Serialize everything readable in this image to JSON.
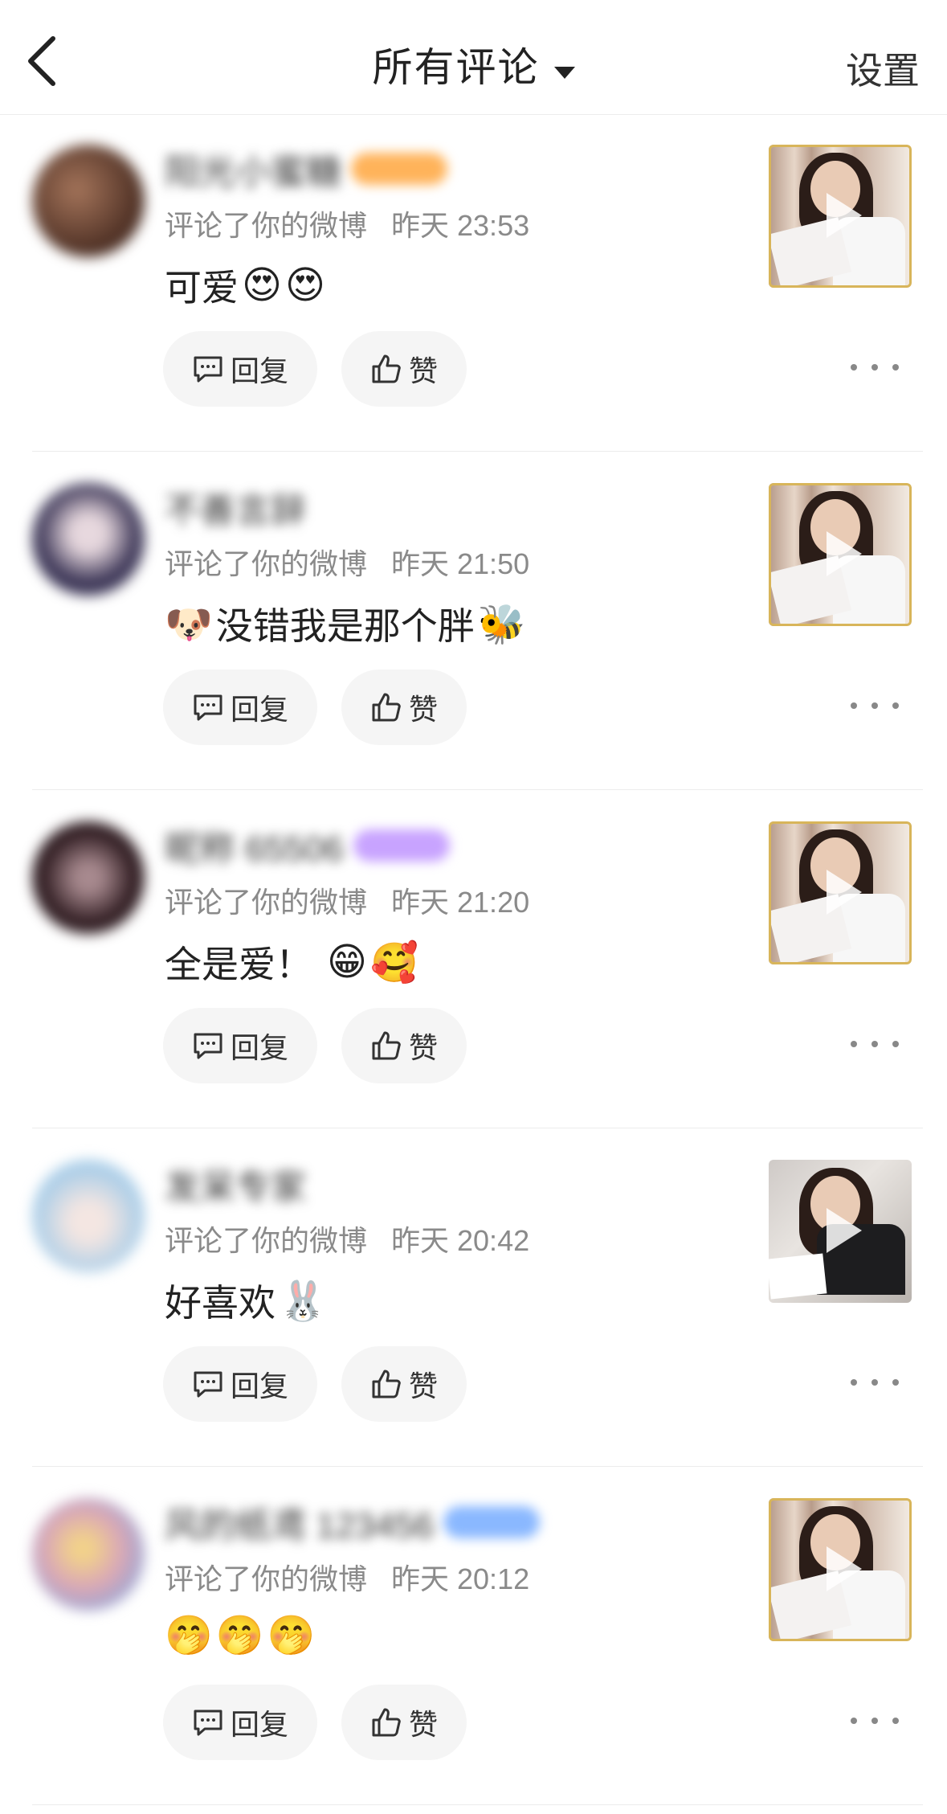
{
  "header": {
    "title": "所有评论",
    "settings_label": "设置"
  },
  "comments": [
    {
      "nickname": "阳光小蜜糖",
      "action": "评论了你的微博",
      "time": "昨天 23:53",
      "text": "可爱",
      "emojis": [
        "😍",
        "😍"
      ],
      "avatar_color": "#5a3b2c",
      "badge_color": "#ffb35a",
      "reply_label": "回复",
      "like_label": "赞"
    },
    {
      "nickname": "不善言辞",
      "action": "评论了你的微博",
      "time": "昨天 21:50",
      "text": "没错我是那个胖",
      "emoji_before": "🐶",
      "emojis": [
        "🐝"
      ],
      "avatar_color": "#3b3556",
      "badge_color": "",
      "reply_label": "回复",
      "like_label": "赞"
    },
    {
      "nickname": "昵称 65506",
      "action": "评论了你的微博",
      "time": "昨天 21:20",
      "text": "全是爱！",
      "emojis": [
        "😁",
        "🥰"
      ],
      "avatar_color": "#3a2429",
      "badge_color": "#c8a3ff",
      "reply_label": "回复",
      "like_label": "赞"
    },
    {
      "nickname": "发呆专家",
      "action": "评论了你的微博",
      "time": "昨天 20:42",
      "text": "好喜欢",
      "emojis": [
        "🐰"
      ],
      "avatar_color": "#bcd9ee",
      "badge_color": "",
      "reply_label": "回复",
      "like_label": "赞"
    },
    {
      "nickname": "风的纸鸢 123456",
      "action": "评论了你的微博",
      "time": "昨天 20:12",
      "text": "",
      "emojis": [
        "🤭",
        "🤭",
        "🤭"
      ],
      "avatar_color": "#d9a7b7",
      "badge_color": "#8ab8ff",
      "reply_label": "回复",
      "like_label": "赞"
    }
  ]
}
